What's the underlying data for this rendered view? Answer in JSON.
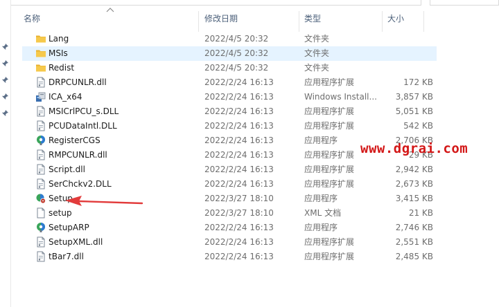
{
  "columns": {
    "name": "名称",
    "date": "修改日期",
    "type": "类型",
    "size": "大小"
  },
  "files": [
    {
      "name": "Lang",
      "date": "2022/4/5 20:32",
      "type": "文件夹",
      "size": "",
      "icon": "folder-icon"
    },
    {
      "name": "MSIs",
      "date": "2022/4/5 20:32",
      "type": "文件夹",
      "size": "",
      "icon": "folder-icon",
      "selected": true
    },
    {
      "name": "Redist",
      "date": "2022/4/5 20:32",
      "type": "文件夹",
      "size": "",
      "icon": "folder-icon"
    },
    {
      "name": "DRPCUNLR.dll",
      "date": "2022/2/24 16:13",
      "type": "应用程序扩展",
      "size": "172 KB",
      "icon": "dll-file-icon"
    },
    {
      "name": "ICA_x64",
      "date": "2022/2/24 16:13",
      "type": "Windows Install...",
      "size": "3,857 KB",
      "icon": "installer-package-icon"
    },
    {
      "name": "MSICrlPCU_s.DLL",
      "date": "2022/2/24 16:13",
      "type": "应用程序扩展",
      "size": "5,051 KB",
      "icon": "dll-file-icon"
    },
    {
      "name": "PCUDataIntl.DLL",
      "date": "2022/2/24 16:13",
      "type": "应用程序扩展",
      "size": "542 KB",
      "icon": "dll-file-icon"
    },
    {
      "name": "RegisterCGS",
      "date": "2022/2/24 16:13",
      "type": "应用程序",
      "size": "2,706 KB",
      "icon": "app-exe-icon"
    },
    {
      "name": "RMPCUNLR.dll",
      "date": "2022/2/24 16:13",
      "type": "应用程序扩展",
      "size": "29 KB",
      "icon": "dll-file-icon"
    },
    {
      "name": "Script.dll",
      "date": "2022/2/24 16:13",
      "type": "应用程序扩展",
      "size": "2,942 KB",
      "icon": "dll-file-icon"
    },
    {
      "name": "SerChckv2.DLL",
      "date": "2022/2/24 16:13",
      "type": "应用程序扩展",
      "size": "2,673 KB",
      "icon": "dll-file-icon"
    },
    {
      "name": "Setup",
      "date": "2022/3/27 18:10",
      "type": "应用程序",
      "size": "3,415 KB",
      "icon": "setup-exe-icon"
    },
    {
      "name": "setup",
      "date": "2022/3/27 18:10",
      "type": "XML 文档",
      "size": "21 KB",
      "icon": "xml-document-icon"
    },
    {
      "name": "SetupARP",
      "date": "2022/2/24 16:13",
      "type": "应用程序",
      "size": "2,746 KB",
      "icon": "app-exe-icon"
    },
    {
      "name": "SetupXML.dll",
      "date": "2022/2/24 16:13",
      "type": "应用程序扩展",
      "size": "2,551 KB",
      "icon": "dll-file-icon"
    },
    {
      "name": "tBar7.dll",
      "date": "2022/2/24 16:13",
      "type": "应用程序扩展",
      "size": "2,485 KB",
      "icon": "dll-file-icon"
    }
  ],
  "watermark": "www.dgrai.com",
  "colors": {
    "selected_row": "#e5f3ff",
    "folder": "#f4c64a",
    "watermark": "#d31717",
    "header_text": "#4c607a"
  }
}
